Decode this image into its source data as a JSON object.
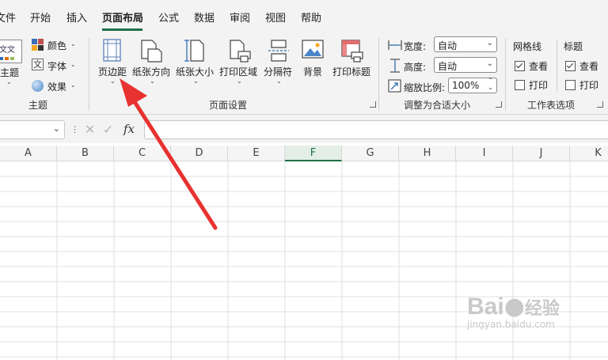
{
  "menu": {
    "file": "文件",
    "home": "开始",
    "insert": "插入",
    "page_layout": "页面布局",
    "formulas": "公式",
    "data": "数据",
    "review": "审阅",
    "view": "视图",
    "help": "帮助"
  },
  "ribbon": {
    "themes": {
      "theme_btn": "主题",
      "colors": "颜色",
      "fonts": "字体",
      "effects": "效果",
      "group_label": "主题",
      "theme_icon_text": "文文"
    },
    "page_setup": {
      "margins": "页边距",
      "orientation": "纸张方向",
      "size": "纸张大小",
      "print_area": "打印区域",
      "breaks": "分隔符",
      "background": "背景",
      "print_titles": "打印标题",
      "group_label": "页面设置"
    },
    "scale_to_fit": {
      "width_label": "宽度:",
      "width_value": "自动",
      "height_label": "高度:",
      "height_value": "自动",
      "scale_label": "缩放比例:",
      "scale_value": "100%",
      "group_label": "调整为合适大小"
    },
    "sheet_options": {
      "gridlines": "网格线",
      "gridlines_view": "查看",
      "gridlines_print": "打印",
      "headings": "标题",
      "headings_view": "查看",
      "headings_print": "打印",
      "group_label": "工作表选项"
    }
  },
  "formula_bar": {
    "fx": "fx"
  },
  "columns": [
    "A",
    "B",
    "C",
    "D",
    "E",
    "F",
    "G",
    "H",
    "I",
    "J",
    "K"
  ],
  "selected_column": "F",
  "watermark": {
    "brand": "Bai",
    "suffix": "经验",
    "url": "jingyan.baidu.com"
  },
  "colors": {
    "accent": "#1e7145",
    "arrow": "#e8322f"
  }
}
